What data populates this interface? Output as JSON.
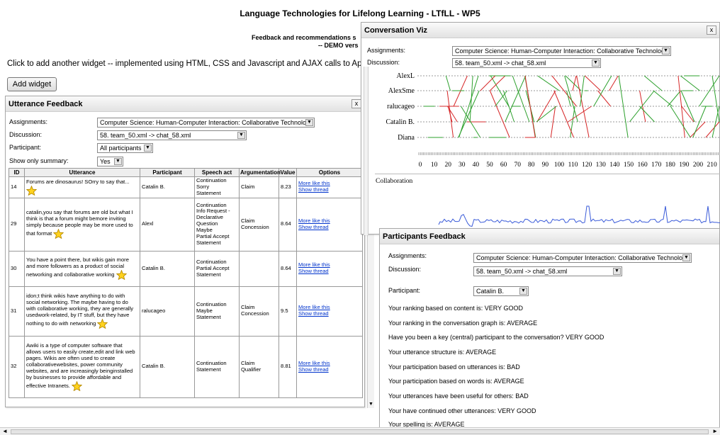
{
  "page": {
    "title": "Language Technologies for Lifelong Learning - LTfLL - WP5",
    "subtitle_line1": "Feedback and recommendations s",
    "subtitle_line2": "-- DEMO vers",
    "intro": "Click to add another widget -- implemented using HTML, CSS and Javascript and AJAX calls to Apache/PHP",
    "add_widget": "Add widget"
  },
  "utterance_feedback": {
    "title": "Utterance Feedback",
    "close": "x",
    "assignments_label": "Assignments:",
    "assignments_value": "Computer Science: Human-Computer Interaction: Collaborative Technology",
    "discussion_label": "Discussion:",
    "discussion_value": "58. team_50.xml -> chat_58.xml",
    "participant_label": "Participant:",
    "participant_value": "All participants",
    "summary_label": "Show only summary:",
    "summary_value": "Yes",
    "columns": [
      "ID",
      "Utterance",
      "Participant",
      "Speech act",
      "Argumentation",
      "Value",
      "Options"
    ],
    "rows": [
      {
        "id": "14",
        "utterance": "Forums are dinosaurus! SOrry to say that...",
        "participant": "Catalin B.",
        "speech": [
          "Continuation",
          "Sorry",
          "Statement"
        ],
        "arg": [
          "Claim"
        ],
        "value": "8.23",
        "opt1": "More like this",
        "opt2": "Show thread"
      },
      {
        "id": "29",
        "utterance": "catalin,you say that forums are old but what I think is that a forum might bemore inviting simply because people may be more used to that format",
        "participant": "Alexl",
        "speech": [
          "Continuation",
          "Info Request -",
          "Declarative",
          "Question",
          "Maybe",
          "Partial Accept",
          "Statement"
        ],
        "arg": [
          "Claim",
          "Concession"
        ],
        "value": "8.64",
        "opt1": "More like this",
        "opt2": "Show thread"
      },
      {
        "id": "30",
        "utterance": "You have a point there, but wikis gain more and more followers as a product of social networking and collaborative working",
        "participant": "Catalin B.",
        "speech": [
          "Continuation",
          "Partial Accept",
          "Statement"
        ],
        "arg": [],
        "value": "8.64",
        "opt1": "More like this",
        "opt2": "Show thread"
      },
      {
        "id": "31",
        "utterance": "idon;t think wikis have anything to do with social networking. The maybe having to do with collaborative working, they are generally usedwork-related, by IT stuff, but they have nothing to do with networking",
        "participant": "ralucageo",
        "speech": [
          "Continuation",
          "Maybe",
          "Statement"
        ],
        "arg": [
          "Claim",
          "Concession"
        ],
        "value": "9.5",
        "opt1": "More like this",
        "opt2": "Show thread"
      },
      {
        "id": "32",
        "utterance": "Awiki is a type of computer software that allows users to easily create,edit and link web pages. Wikis are often used to create collaborativewebsites, power community websites, and are increasingly beinginstalled by businesses to provide affordable and effective Intranets.",
        "participant": "Catalin B.",
        "speech": [
          "Continuation",
          "Statement"
        ],
        "arg": [
          "Claim",
          "Qualifier"
        ],
        "value": "8.81",
        "opt1": "More like this",
        "opt2": "Show thread"
      }
    ]
  },
  "conversation_viz": {
    "title": "Conversation Viz",
    "close": "x",
    "assignments_label": "Assignments:",
    "assignments_value": "Computer Science: Human-Computer Interaction: Collaborative Technology",
    "discussion_label": "Discussion:",
    "discussion_value": "58. team_50.xml -> chat_58.xml",
    "participants": [
      "AlexL",
      "AlexSme",
      "ralucageo",
      "Catalin B.",
      "Diana"
    ],
    "ticks": [
      "0",
      "10",
      "20",
      "30",
      "40",
      "50",
      "60",
      "70",
      "80",
      "90",
      "100",
      "110",
      "120",
      "130",
      "140",
      "150",
      "160",
      "170",
      "180",
      "190",
      "200",
      "210"
    ],
    "collab_label": "Collaboration",
    "colors": {
      "green": "#2ca02c",
      "red": "#d62728",
      "blue": "#3a5bd9"
    }
  },
  "participants_feedback": {
    "title": "Participants Feedback",
    "assignments_label": "Assignments:",
    "assignments_value": "Computer Science: Human-Computer Interaction: Collaborative Technology",
    "discussion_label": "Discussion:",
    "discussion_value": "58. team_50.xml -> chat_58.xml",
    "participant_label": "Participant:",
    "participant_value": "Catalin B.",
    "lines": [
      "Your ranking based on content is: VERY GOOD",
      "Your ranking in the conversation graph is: AVERAGE",
      "Have you been a key (central) participant to the conversation? VERY GOOD",
      "Your utterance structure is: AVERAGE",
      "Your participation based on utterances is: BAD",
      "Your participation based on words is: AVERAGE",
      "Your utterances have been useful for others: BAD",
      "Your have continued other utterances: VERY GOOD",
      "Your spelling is: AVERAGE"
    ]
  }
}
